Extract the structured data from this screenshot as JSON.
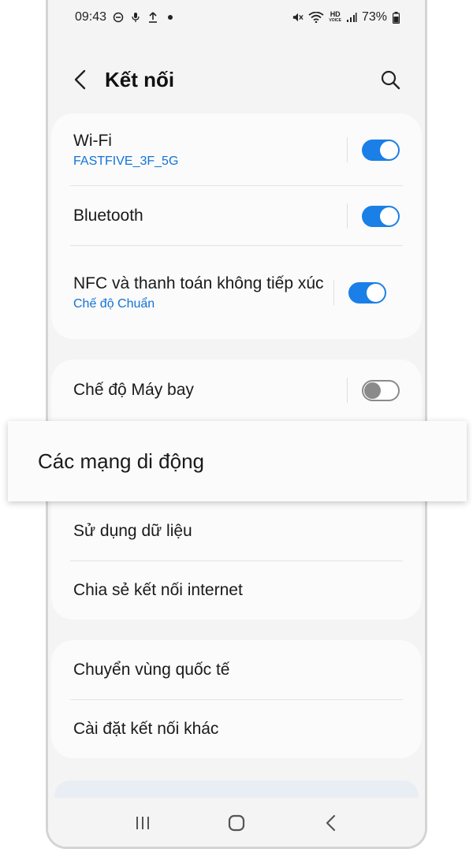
{
  "statusbar": {
    "time": "09:43",
    "battery": "73%",
    "hd_label": "HD",
    "volte_label": "VOICE"
  },
  "header": {
    "title": "Kết nối"
  },
  "group1": [
    {
      "label": "Wi-Fi",
      "sub": "FASTFIVE_3F_5G",
      "toggle": true
    },
    {
      "label": "Bluetooth",
      "sub": "",
      "toggle": true
    },
    {
      "label": "NFC và thanh toán không tiếp xúc",
      "sub": "Chế độ Chuẩn",
      "toggle": true
    }
  ],
  "group2": {
    "airplane": {
      "label": "Chế độ Máy bay",
      "toggle": false
    },
    "mobile_networks": {
      "label": "Các mạng di động"
    },
    "data_usage": {
      "label": "Sử dụng dữ liệu"
    },
    "hotspot": {
      "label": "Chia sẻ kết nối internet"
    }
  },
  "group3": [
    {
      "label": "Chuyển vùng quốc tế"
    },
    {
      "label": "Cài đặt kết nối khác"
    }
  ],
  "colors": {
    "accent": "#1a7fe6",
    "link": "#1273d6"
  }
}
